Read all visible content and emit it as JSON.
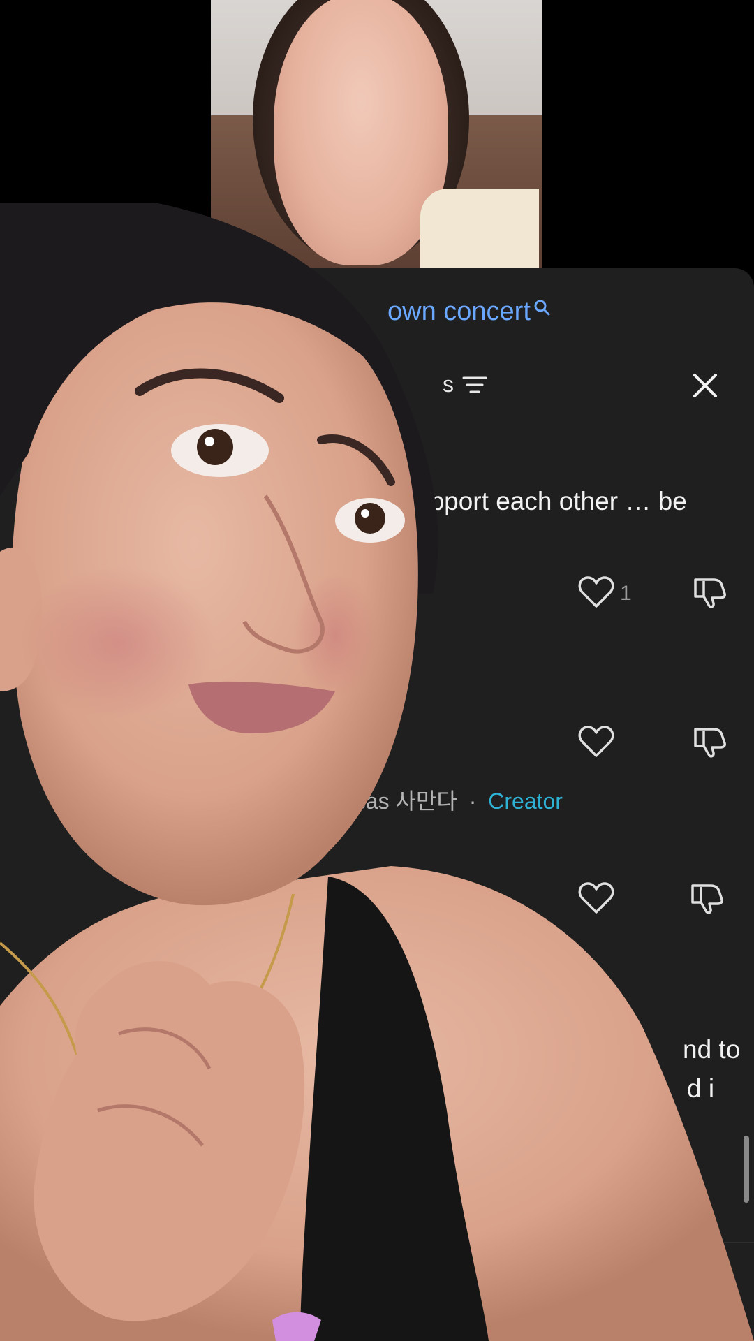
{
  "search": {
    "query": "own concert"
  },
  "sort": {
    "label": "s"
  },
  "comments": [
    {
      "text": "upport each other … be",
      "likes": "1"
    },
    {
      "text": "",
      "likes": ""
    },
    {
      "author": "nsas 사만다",
      "separator": "·",
      "badge": "Creator",
      "text_line1": "nd to",
      "text_line2": "d i",
      "likes": ""
    }
  ],
  "icons": [
    "search-icon",
    "sort-icon",
    "close-icon",
    "heart-icon",
    "dislike-icon"
  ],
  "colors": {
    "link": "#6aa7ff",
    "creator": "#2fb1d4",
    "panel": "#1f1f1f"
  }
}
